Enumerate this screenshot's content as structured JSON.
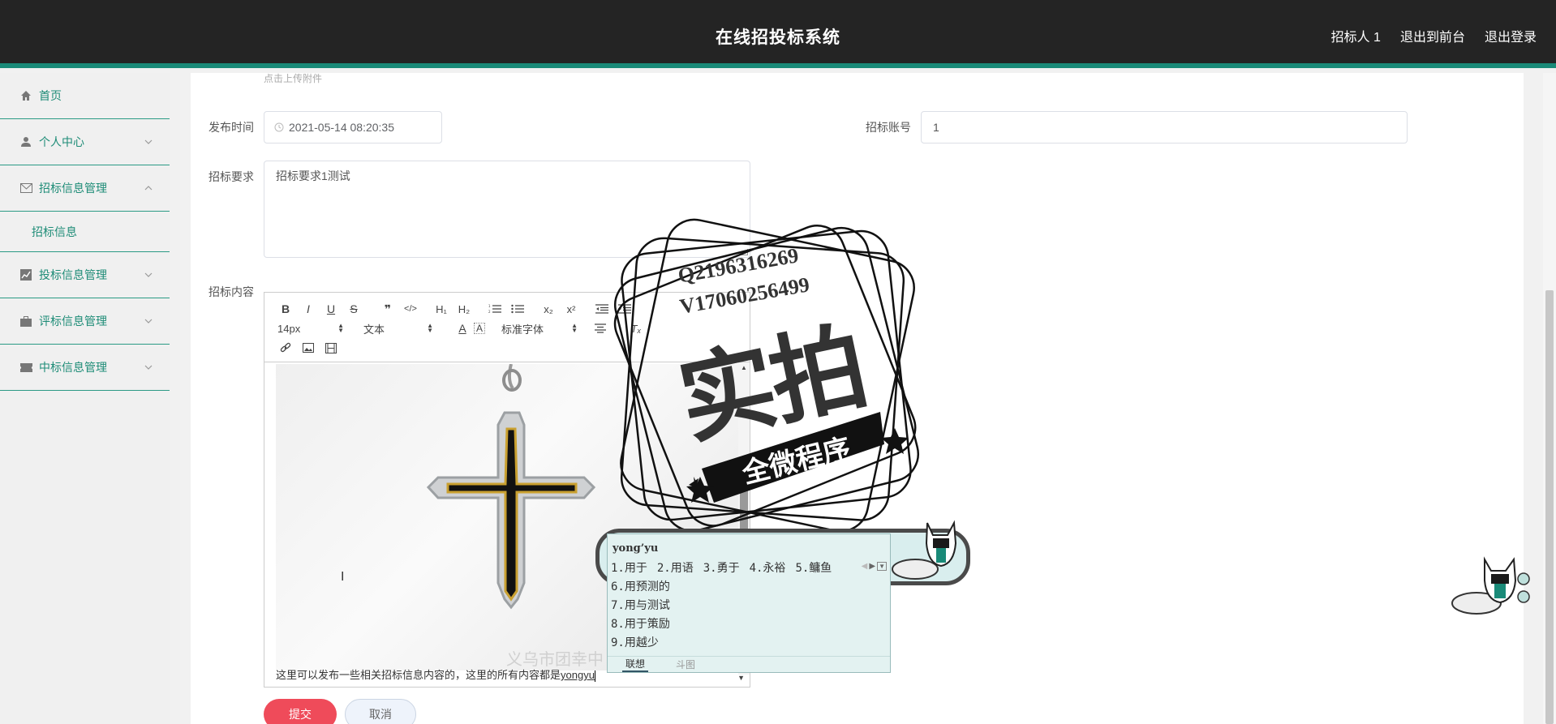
{
  "header": {
    "title": "在线招投标系统",
    "nav": [
      "招标人 1",
      "退出到前台",
      "退出登录"
    ]
  },
  "sidebar": {
    "items": [
      {
        "label": "首页",
        "icon": "home-icon"
      },
      {
        "label": "个人中心",
        "icon": "user-icon"
      },
      {
        "label": "招标信息管理",
        "icon": "mail-icon",
        "expanded": true,
        "sub": [
          "招标信息"
        ]
      },
      {
        "label": "投标信息管理",
        "icon": "chart-icon"
      },
      {
        "label": "评标信息管理",
        "icon": "briefcase-icon"
      },
      {
        "label": "中标信息管理",
        "icon": "ticket-icon"
      }
    ]
  },
  "form": {
    "upload_hint": "点击上传附件",
    "publish_time_label": "发布时间",
    "publish_time_value": "2021-05-14 08:20:35",
    "account_label": "招标账号",
    "account_value": "1",
    "requirement_label": "招标要求",
    "requirement_value": "招标要求1测试",
    "content_label": "招标内容"
  },
  "editor": {
    "font_size": "14px",
    "block_format": "文本",
    "font_family": "标准字体",
    "body_text": "这里可以发布一些相关招标信息内容的，这里的所有内容都是",
    "composing_text": "yongyu",
    "image_caption": "义乌市团幸中"
  },
  "buttons": {
    "submit": "提交",
    "cancel": "取消"
  },
  "watermark": {
    "qq": "Q2196316269",
    "wx": "V17060256499",
    "big": "实拍",
    "ribbon": "全微程序"
  },
  "ime": {
    "pinyin": "yong’yu",
    "candidates_row": [
      "1.用于",
      "2.用语",
      "3.勇于",
      "4.永裕",
      "5.鳙鱼"
    ],
    "candidates_more": [
      "6.用预测的",
      "7.用与测试",
      "8.用于策励",
      "9.用越少"
    ],
    "tabs": [
      "联想",
      "斗图"
    ]
  },
  "colors": {
    "accent": "#1e8c77",
    "header_bg": "#242424",
    "submit": "#ef4b5a"
  }
}
